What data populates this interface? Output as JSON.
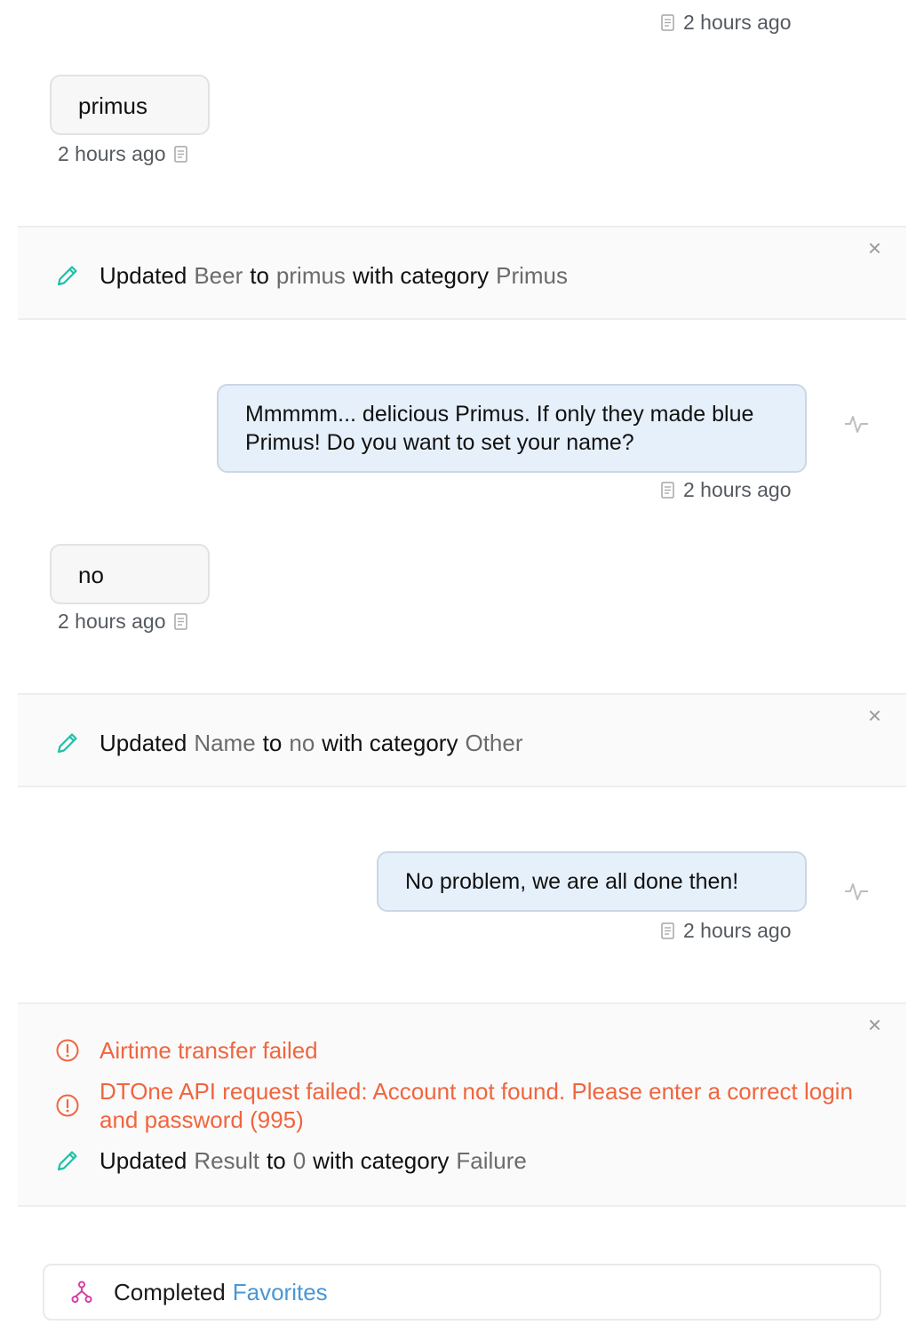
{
  "messages": [
    {
      "direction": "out",
      "time": "2 hours ago"
    },
    {
      "direction": "in",
      "text": "primus",
      "time": "2 hours ago"
    },
    {
      "direction": "out",
      "text": "Mmmmm... delicious Primus. If only they made blue Primus! Do you want to set your name?",
      "time": "2 hours ago"
    },
    {
      "direction": "in",
      "text": "no",
      "time": "2 hours ago"
    },
    {
      "direction": "out",
      "text": "No problem, we are all done then!",
      "time": "2 hours ago"
    }
  ],
  "events": [
    {
      "close": "×",
      "updates": [
        {
          "verb": "Updated",
          "field": "Beer",
          "to": "to",
          "value": "primus",
          "with": "with category",
          "category": "Primus"
        }
      ]
    },
    {
      "close": "×",
      "updates": [
        {
          "verb": "Updated",
          "field": "Name",
          "to": "to",
          "value": "no",
          "with": "with category",
          "category": "Other"
        }
      ]
    },
    {
      "close": "×",
      "errors": [
        "Airtime transfer failed",
        "DTOne API request failed: Account not found. Please enter a correct login and password (995)"
      ],
      "updates": [
        {
          "verb": "Updated",
          "field": "Result",
          "to": "to",
          "value": "0",
          "with": "with category",
          "category": "Failure"
        }
      ]
    }
  ],
  "flow": {
    "status": "Completed",
    "name": "Favorites"
  },
  "colors": {
    "accent_link": "#4a97d6",
    "error": "#f0653f",
    "edit_icon": "#1fbfa8",
    "flow_icon": "#d63fa7",
    "out_bubble": "#e6f0fb",
    "in_bubble": "#f7f7f7"
  },
  "icons": {
    "timestamp": "document-icon",
    "out_message": "pulse-icon",
    "update": "pencil-icon",
    "error": "alert-circle-icon",
    "flow": "flow-branch-icon",
    "close": "close-icon"
  }
}
